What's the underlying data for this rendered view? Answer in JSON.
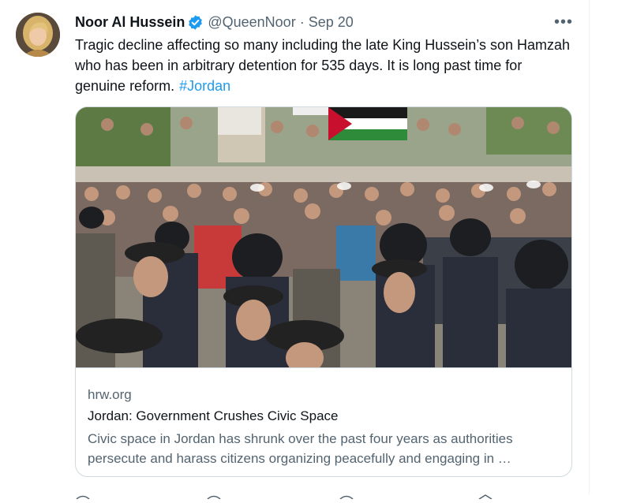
{
  "tweet": {
    "author_name": "Noor Al Hussein",
    "handle": "@QueenNoor",
    "separator": "·",
    "date": "Sep 20",
    "more_label": "•••",
    "text": "Tragic decline affecting so many including the late King Hussein’s son Hamzah who has been in arbitrary detention for 535 days. It is long past time for genuine reform.",
    "hashtag": "#Jordan"
  },
  "card": {
    "domain": "hrw.org",
    "title": "Jordan: Government Crushes Civic Space",
    "description": "Civic space in Jordan has shrunk over the past four years as authorities persecute and harass citizens organizing peacefully and engaging in …"
  },
  "colors": {
    "accent": "#1d9bf0",
    "secondary_text": "#536471",
    "border": "#cfd9de"
  },
  "icons": {
    "verified": "verified-badge-icon",
    "more": "more-options-icon"
  }
}
